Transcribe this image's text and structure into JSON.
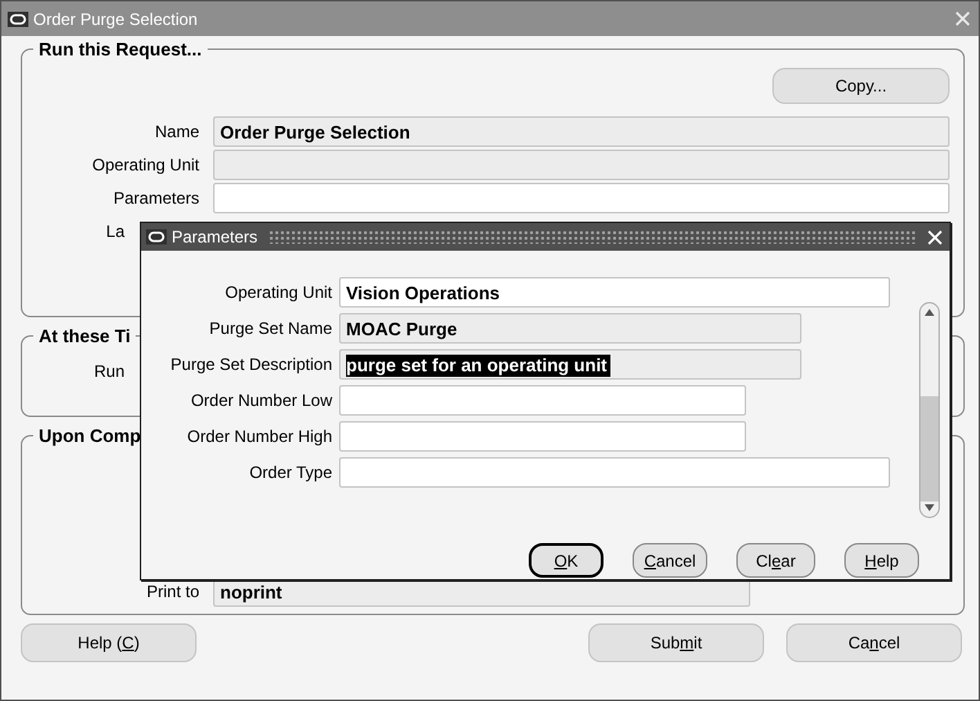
{
  "window": {
    "title": "Order Purge Selection"
  },
  "request_group": {
    "title": "Run this Request...",
    "copy_button": {
      "label": "Copy..."
    },
    "fields": [
      {
        "label": "Name",
        "value": "Order Purge Selection",
        "kind": "readonly"
      },
      {
        "label": "Operating Unit",
        "kind": "readonly"
      },
      {
        "label": "Parameters",
        "kind": "editable"
      },
      {
        "label": "La"
      }
    ]
  },
  "schedule_group": {
    "title": "At these Ti",
    "fields": [
      {
        "label": "Run"
      }
    ]
  },
  "completion_group": {
    "title": "Upon Comp",
    "fields": [
      {
        "label": "Print to",
        "value": "noprint",
        "kind": "readonly"
      }
    ]
  },
  "buttons": [
    {
      "label_before": "Help (",
      "mnemonic": "C",
      "label_after": ")"
    },
    {
      "label_before": "Sub",
      "mnemonic": "m",
      "label_after": "it"
    },
    {
      "label_before": "Ca",
      "mnemonic": "n",
      "label_after": "cel"
    }
  ],
  "dialog": {
    "title": "Parameters",
    "fields": [
      {
        "label": "Operating Unit",
        "value": "Vision Operations",
        "kind": "editable",
        "selected": false
      },
      {
        "label": "Purge Set Name",
        "value": "MOAC Purge",
        "kind": "readonly",
        "selected": false
      },
      {
        "label": "Purge Set Description",
        "value": "purge set for an operating unit",
        "kind": "readonly",
        "selected": true
      },
      {
        "label": "Order Number Low",
        "kind": "editable",
        "selected": false
      },
      {
        "label": "Order Number High",
        "kind": "editable",
        "selected": false
      },
      {
        "label": "Order Type",
        "kind": "editable",
        "selected": false
      }
    ],
    "buttons": [
      {
        "mnemonic": "O",
        "label_after": "K",
        "default": true
      },
      {
        "mnemonic": "C",
        "label_after": "ancel",
        "default": false
      },
      {
        "label_before": "Cl",
        "mnemonic": "e",
        "label_after": "ar",
        "default": false
      },
      {
        "mnemonic": "H",
        "label_after": "elp",
        "default": false
      }
    ]
  }
}
